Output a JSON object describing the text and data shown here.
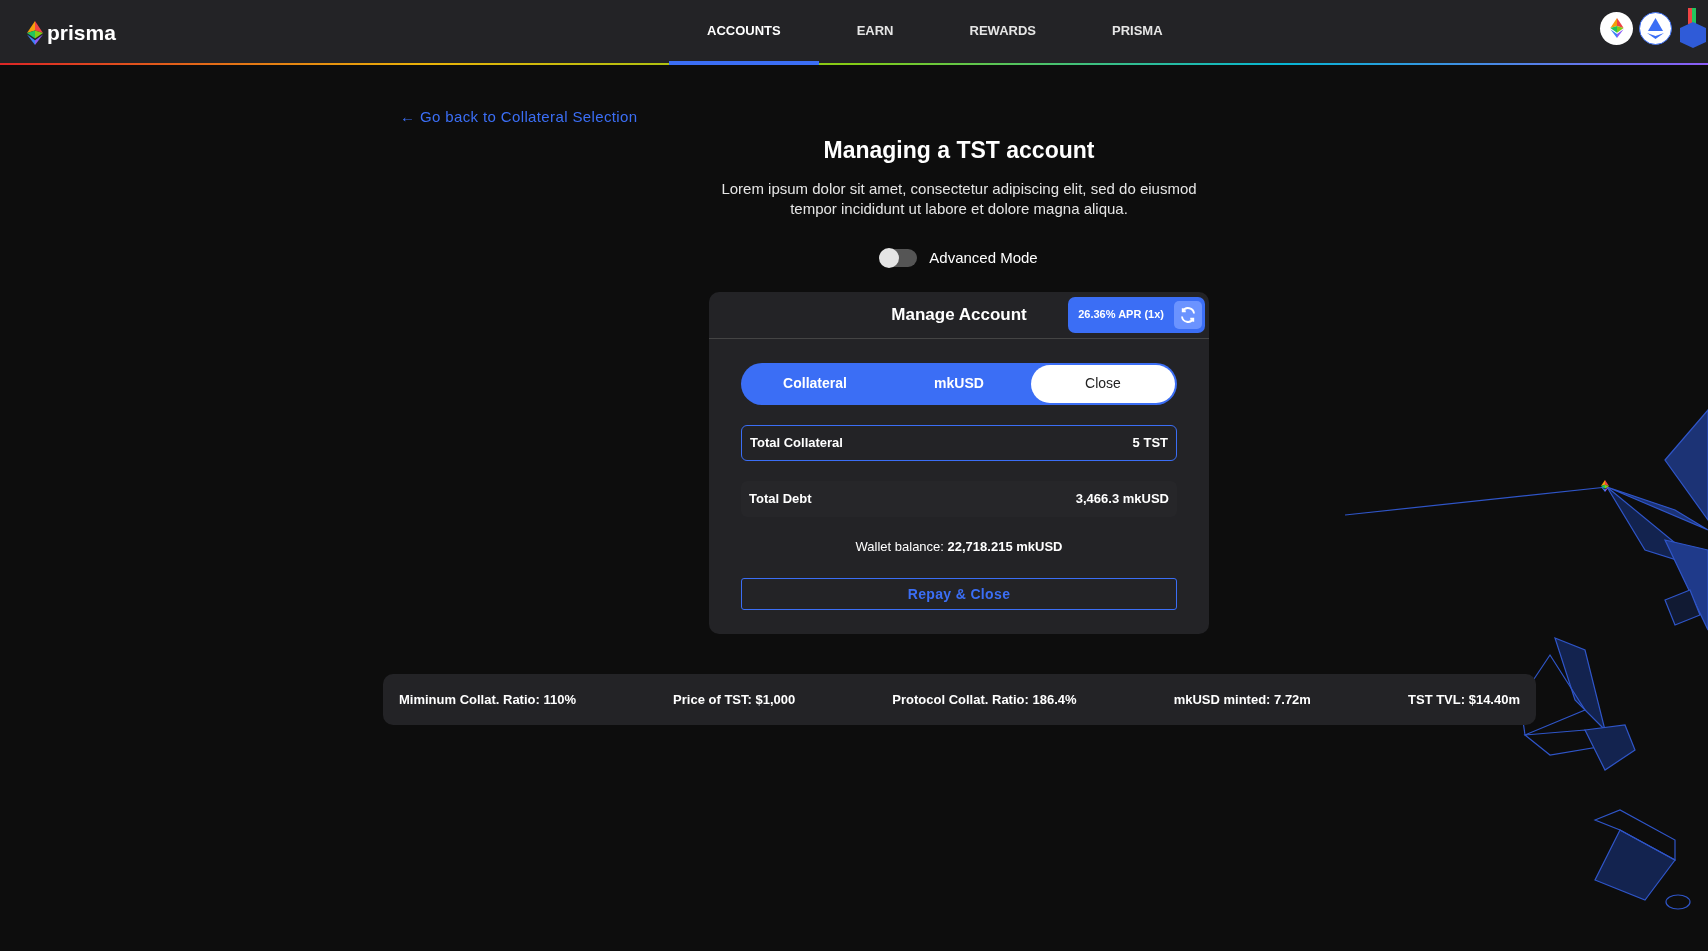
{
  "header": {
    "logo_text": "prisma",
    "nav": [
      {
        "label": "ACCOUNTS",
        "selected": true
      },
      {
        "label": "EARN",
        "selected": false
      },
      {
        "label": "REWARDS",
        "selected": false
      },
      {
        "label": "PRISMA",
        "selected": false
      }
    ]
  },
  "back_link": "← Go back to Collateral Selection",
  "title": "Managing a TST account",
  "description": "Lorem ipsum dolor sit amet, consectetur adipiscing elit, sed do eiusmod tempor incididunt ut labore et dolore magna aliqua.",
  "advanced_mode": {
    "label": "Advanced Mode",
    "on": false
  },
  "card": {
    "title": "Manage Account",
    "apr_badge": "26.36% APR (1x)",
    "tabs": [
      {
        "label": "Collateral",
        "selected": false
      },
      {
        "label": "mkUSD",
        "selected": false
      },
      {
        "label": "Close",
        "selected": true
      }
    ],
    "rows": [
      {
        "label": "Total Collateral",
        "value": "5 TST",
        "kind": "outlined"
      },
      {
        "label": "Total Debt",
        "value": "3,466.3 mkUSD",
        "kind": "plain"
      }
    ],
    "wallet_balance": "Wallet balance: **22,718.215 mkUSD**",
    "action_button": "Repay & Close"
  },
  "stats": [
    "Miminum Collat. Ratio: 110%",
    "Price of TST: $1,000",
    "Protocol Collat. Ratio: 186.4%",
    "mkUSD minted: 7.72m",
    "TST TVL: $14.40m"
  ]
}
